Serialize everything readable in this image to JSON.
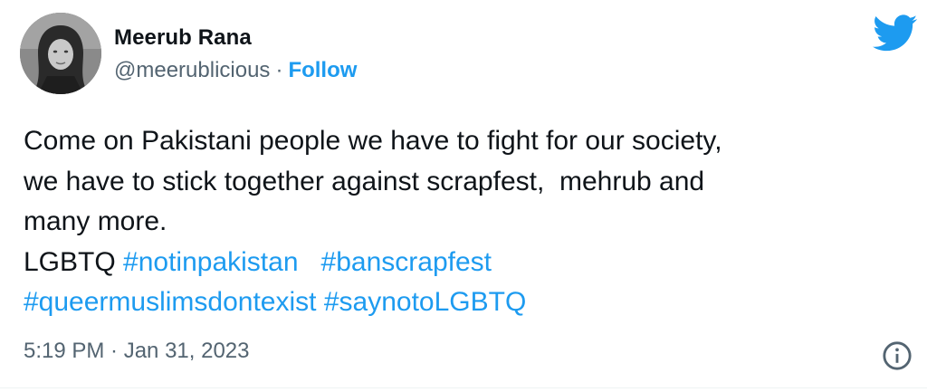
{
  "author": {
    "display_name": "Meerub Rana",
    "handle": "@meerublicious",
    "separator": "·",
    "follow_label": "Follow"
  },
  "tweet": {
    "line1": "Come on Pakistani people we have to fight for our society,",
    "line2": "we have to stick together against scrapfest,  mehrub and",
    "line3": "many more.",
    "line4_text": "LGBTQ ",
    "hashtags": [
      "#notinpakistan",
      "#banscrapfest",
      "#queermuslimsdontexist",
      "#saynotoLGBTQ"
    ],
    "gap": "   ",
    "space": " "
  },
  "meta": {
    "time": "5:19 PM",
    "separator": "·",
    "date": "Jan 31, 2023",
    "timestamp": "5:19 PM · Jan 31, 2023"
  },
  "icons": {
    "brand": "twitter-bird-icon",
    "info": "info-icon",
    "avatar": "profile-photo"
  },
  "colors": {
    "brand_blue": "#1d9bf0",
    "text_primary": "#0f1419",
    "text_secondary": "#536471"
  }
}
